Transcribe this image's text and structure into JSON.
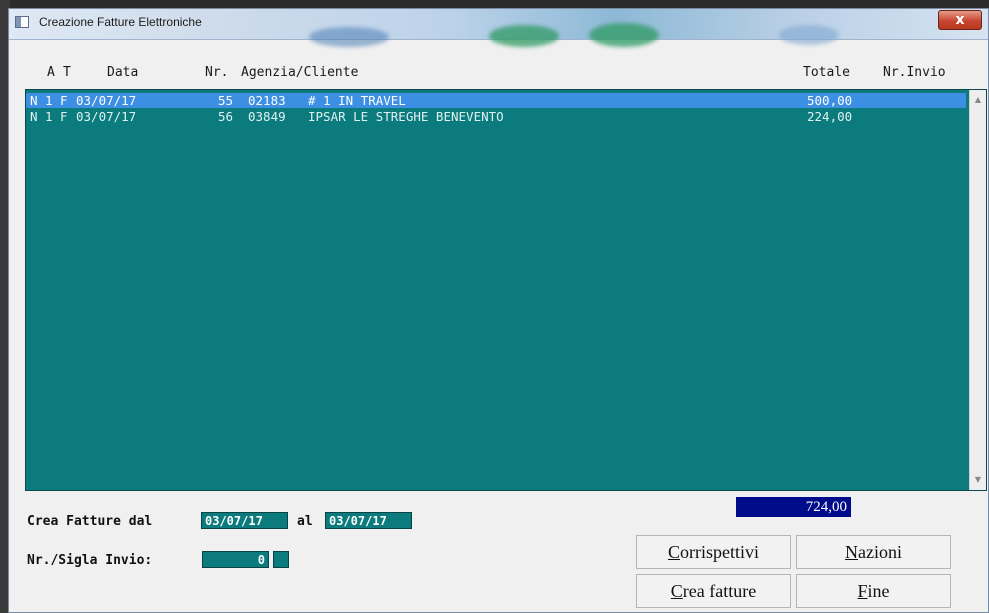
{
  "window": {
    "title": "Creazione Fatture Elettroniche",
    "close_label": "x"
  },
  "columns": [
    "A",
    "T",
    "Data",
    "Nr.",
    "Agenzia/Cliente",
    "Totale",
    "Nr.Invio"
  ],
  "rows": [
    {
      "a": "N",
      "t": "1",
      "tipo": "F",
      "data": "03/07/17",
      "nr": "55",
      "codice": "02183",
      "cliente": "# 1 IN TRAVEL",
      "totale": "500,00",
      "invio": "",
      "selected": true
    },
    {
      "a": "N",
      "t": "1",
      "tipo": "F",
      "data": "03/07/17",
      "nr": "56",
      "codice": "03849",
      "cliente": "IPSAR LE STREGHE BENEVENTO",
      "totale": "224,00",
      "invio": "",
      "selected": false
    }
  ],
  "total": "724,00",
  "form": {
    "crea_label": "Crea Fatture dal",
    "date_from": "03/07/17",
    "al_label": "al",
    "date_to": "03/07/17",
    "sigla_label": "Nr./Sigla Invio:",
    "nr_invio": "0",
    "sigla": ""
  },
  "buttons": {
    "corrispettivi": {
      "first": "C",
      "rest": "orrispettivi"
    },
    "nazioni": {
      "first": "N",
      "rest": "azioni"
    },
    "crea_fatture": {
      "first": "C",
      "rest": "rea fatture"
    },
    "fine": {
      "first": "F",
      "rest": "ine"
    }
  },
  "icons": {
    "app": "window-icon",
    "close": "close-icon",
    "scroll_up": "chevron-up-icon",
    "scroll_down": "chevron-down-icon"
  },
  "colors": {
    "list_bg": "#0b7b7d",
    "selection": "#3d8fe4",
    "total_bg": "#000c8a"
  }
}
